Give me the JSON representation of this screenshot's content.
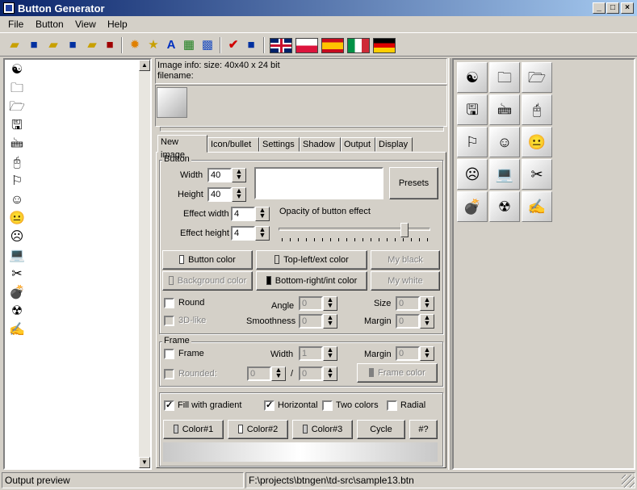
{
  "window": {
    "title": "Button Generator",
    "minimize": "_",
    "maximize": "□",
    "close": "×"
  },
  "menu": [
    "File",
    "Button",
    "View",
    "Help"
  ],
  "toolbar": {
    "icons": [
      "open-folder-icon",
      "save-icon",
      "open-folder-icon",
      "save-as-icon",
      "open-folder-icon",
      "save-icon",
      "explosion-icon",
      "folder-star-icon",
      "font-icon",
      "color-grid-icon",
      "palette-icon",
      "check-icon",
      "save-icon"
    ],
    "flags": [
      "uk-flag-icon",
      "poland-flag-icon",
      "spain-flag-icon",
      "italy-flag-icon",
      "germany-flag-icon"
    ]
  },
  "left_list": {
    "items": [
      {
        "icon": "yin-yang-icon",
        "glyph": "☯"
      },
      {
        "icon": "folder-icon",
        "glyph": "🗀"
      },
      {
        "icon": "open-folder-icon",
        "glyph": "🗁"
      },
      {
        "icon": "floppy-icon",
        "glyph": "🖫"
      },
      {
        "icon": "keyboard-icon",
        "glyph": "🖮"
      },
      {
        "icon": "mouse-icon",
        "glyph": "🖰"
      },
      {
        "icon": "flag-icon",
        "glyph": "⚐"
      },
      {
        "icon": "smile-icon",
        "glyph": "☺"
      },
      {
        "icon": "neutral-face-icon",
        "glyph": "😐"
      },
      {
        "icon": "sad-face-icon",
        "glyph": "☹"
      },
      {
        "icon": "laptop-icon",
        "glyph": "💻"
      },
      {
        "icon": "scissors-icon",
        "glyph": "✂"
      },
      {
        "icon": "bomb-icon",
        "glyph": "💣"
      },
      {
        "icon": "radiation-face-icon",
        "glyph": "☢"
      },
      {
        "icon": "pen-icon",
        "glyph": "✍"
      }
    ]
  },
  "info": {
    "line1": "Image info: size: 40x40 x 24 bit",
    "line2": "filename:"
  },
  "tabs": [
    "New image",
    "Icon/bullet",
    "Settings",
    "Shadow",
    "Output",
    "Display"
  ],
  "button_group": {
    "title": "Button",
    "width_label": "Width",
    "width_value": "40",
    "height_label": "Height",
    "height_value": "40",
    "effect_width_label": "Effect width",
    "effect_width_value": "4",
    "effect_height_label": "Effect height",
    "effect_height_value": "4",
    "presets": "Presets",
    "opacity_label": "Opacity of button effect",
    "opacity_fraction": 0.85,
    "button_color": "Button color",
    "top_left": "Top-left/ext color",
    "my_black": "My black",
    "background_color": "Background color",
    "bottom_right": "Bottom-right/int color",
    "my_white": "My white",
    "round": "Round",
    "three_d": "3D-like",
    "angle_label": "Angle",
    "angle_value": "0",
    "smoothness_label": "Smoothness",
    "smoothness_value": "0",
    "size_label": "Size",
    "size_value": "0",
    "margin_label": "Margin",
    "margin_value": "0"
  },
  "frame_group": {
    "title": "Frame",
    "frame": "Frame",
    "width_label": "Width",
    "width_value": "1",
    "margin_label": "Margin",
    "margin_value": "0",
    "rounded": "Rounded:",
    "rounded_a": "0",
    "slash": "/",
    "rounded_b": "0",
    "frame_color": "Frame color"
  },
  "gradient_group": {
    "fill": "Fill with gradient",
    "horizontal": "Horizontal",
    "two_colors": "Two colors",
    "radial": "Radial",
    "color1": "Color#1",
    "color2": "Color#2",
    "color3": "Color#3",
    "cycle": "Cycle",
    "help": "#?"
  },
  "gallery": {
    "buttons": [
      {
        "icon": "yin-yang-icon",
        "glyph": "☯"
      },
      {
        "icon": "folder-icon",
        "glyph": "🗀"
      },
      {
        "icon": "open-folder-icon",
        "glyph": "🗁"
      },
      {
        "icon": "floppy-icon",
        "glyph": "🖫"
      },
      {
        "icon": "keyboard-icon",
        "glyph": "🖮"
      },
      {
        "icon": "mouse-icon",
        "glyph": "🖰"
      },
      {
        "icon": "flag-icon",
        "glyph": "⚐"
      },
      {
        "icon": "smile-icon",
        "glyph": "☺"
      },
      {
        "icon": "neutral-face-icon",
        "glyph": "😐"
      },
      {
        "icon": "sad-face-icon",
        "glyph": "☹"
      },
      {
        "icon": "laptop-icon",
        "glyph": "💻"
      },
      {
        "icon": "scissors-icon",
        "glyph": "✂"
      },
      {
        "icon": "bomb-icon",
        "glyph": "💣"
      },
      {
        "icon": "radiation-face-icon",
        "glyph": "☢"
      },
      {
        "icon": "pen-icon",
        "glyph": "✍"
      }
    ]
  },
  "status": {
    "left": "Output preview",
    "right": "F:\\projects\\btngen\\td-src\\sample13.btn"
  }
}
